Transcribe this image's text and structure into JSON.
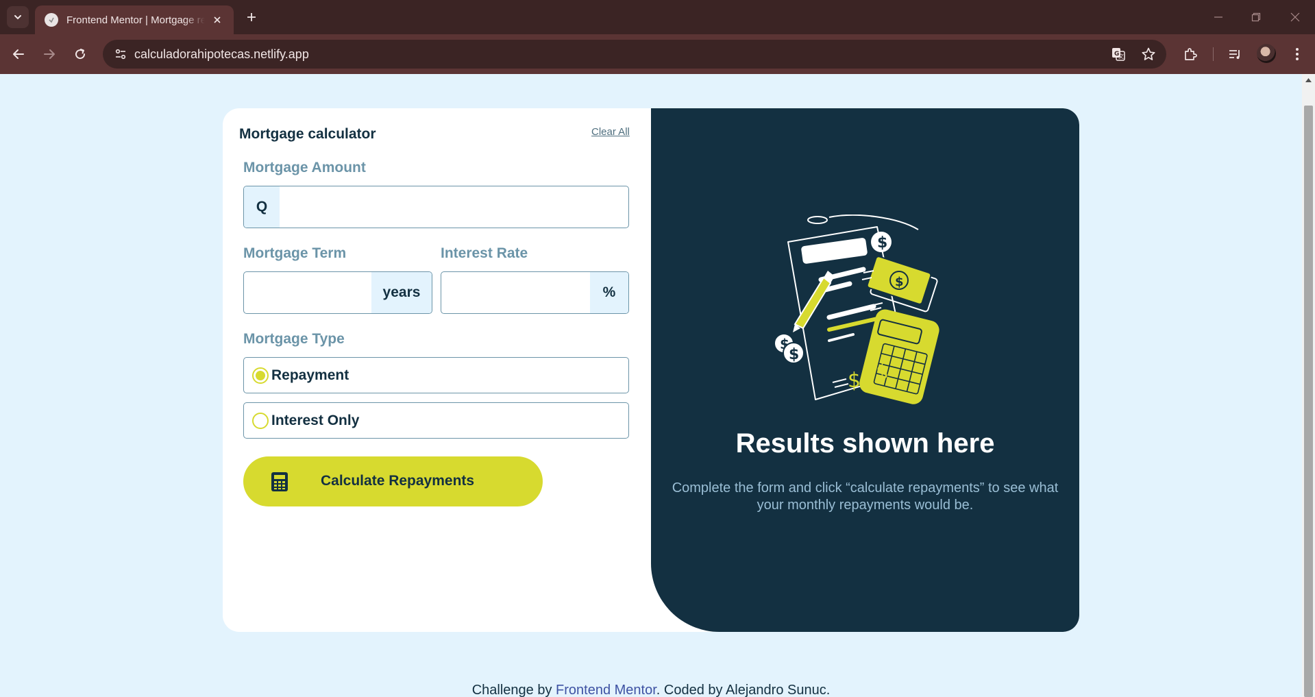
{
  "browser": {
    "tab_title": "Frontend Mentor | Mortgage repayment calculator",
    "url": "calculadorahipotecas.netlify.app"
  },
  "form": {
    "title": "Mortgage calculator",
    "clear_all": "Clear All",
    "amount": {
      "label": "Mortgage Amount",
      "prefix": "Q",
      "value": ""
    },
    "term": {
      "label": "Mortgage Term",
      "suffix": "years",
      "value": ""
    },
    "rate": {
      "label": "Interest Rate",
      "suffix": "%",
      "value": ""
    },
    "type": {
      "label": "Mortgage Type",
      "options": [
        {
          "label": "Repayment",
          "selected": true
        },
        {
          "label": "Interest Only",
          "selected": false
        }
      ]
    },
    "submit_label": "Calculate Repayments"
  },
  "results": {
    "title": "Results shown here",
    "text": "Complete the form and click “calculate repayments” to see what your monthly repayments would be."
  },
  "footer": {
    "prefix": "Challenge by ",
    "link": "Frontend Mentor",
    "suffix": ". Coded by Alejandro Sunuc."
  },
  "colors": {
    "accent": "#d7da2f",
    "dark": "#133041",
    "slate": "#6b94a8",
    "page_bg": "#e3f3fd"
  }
}
